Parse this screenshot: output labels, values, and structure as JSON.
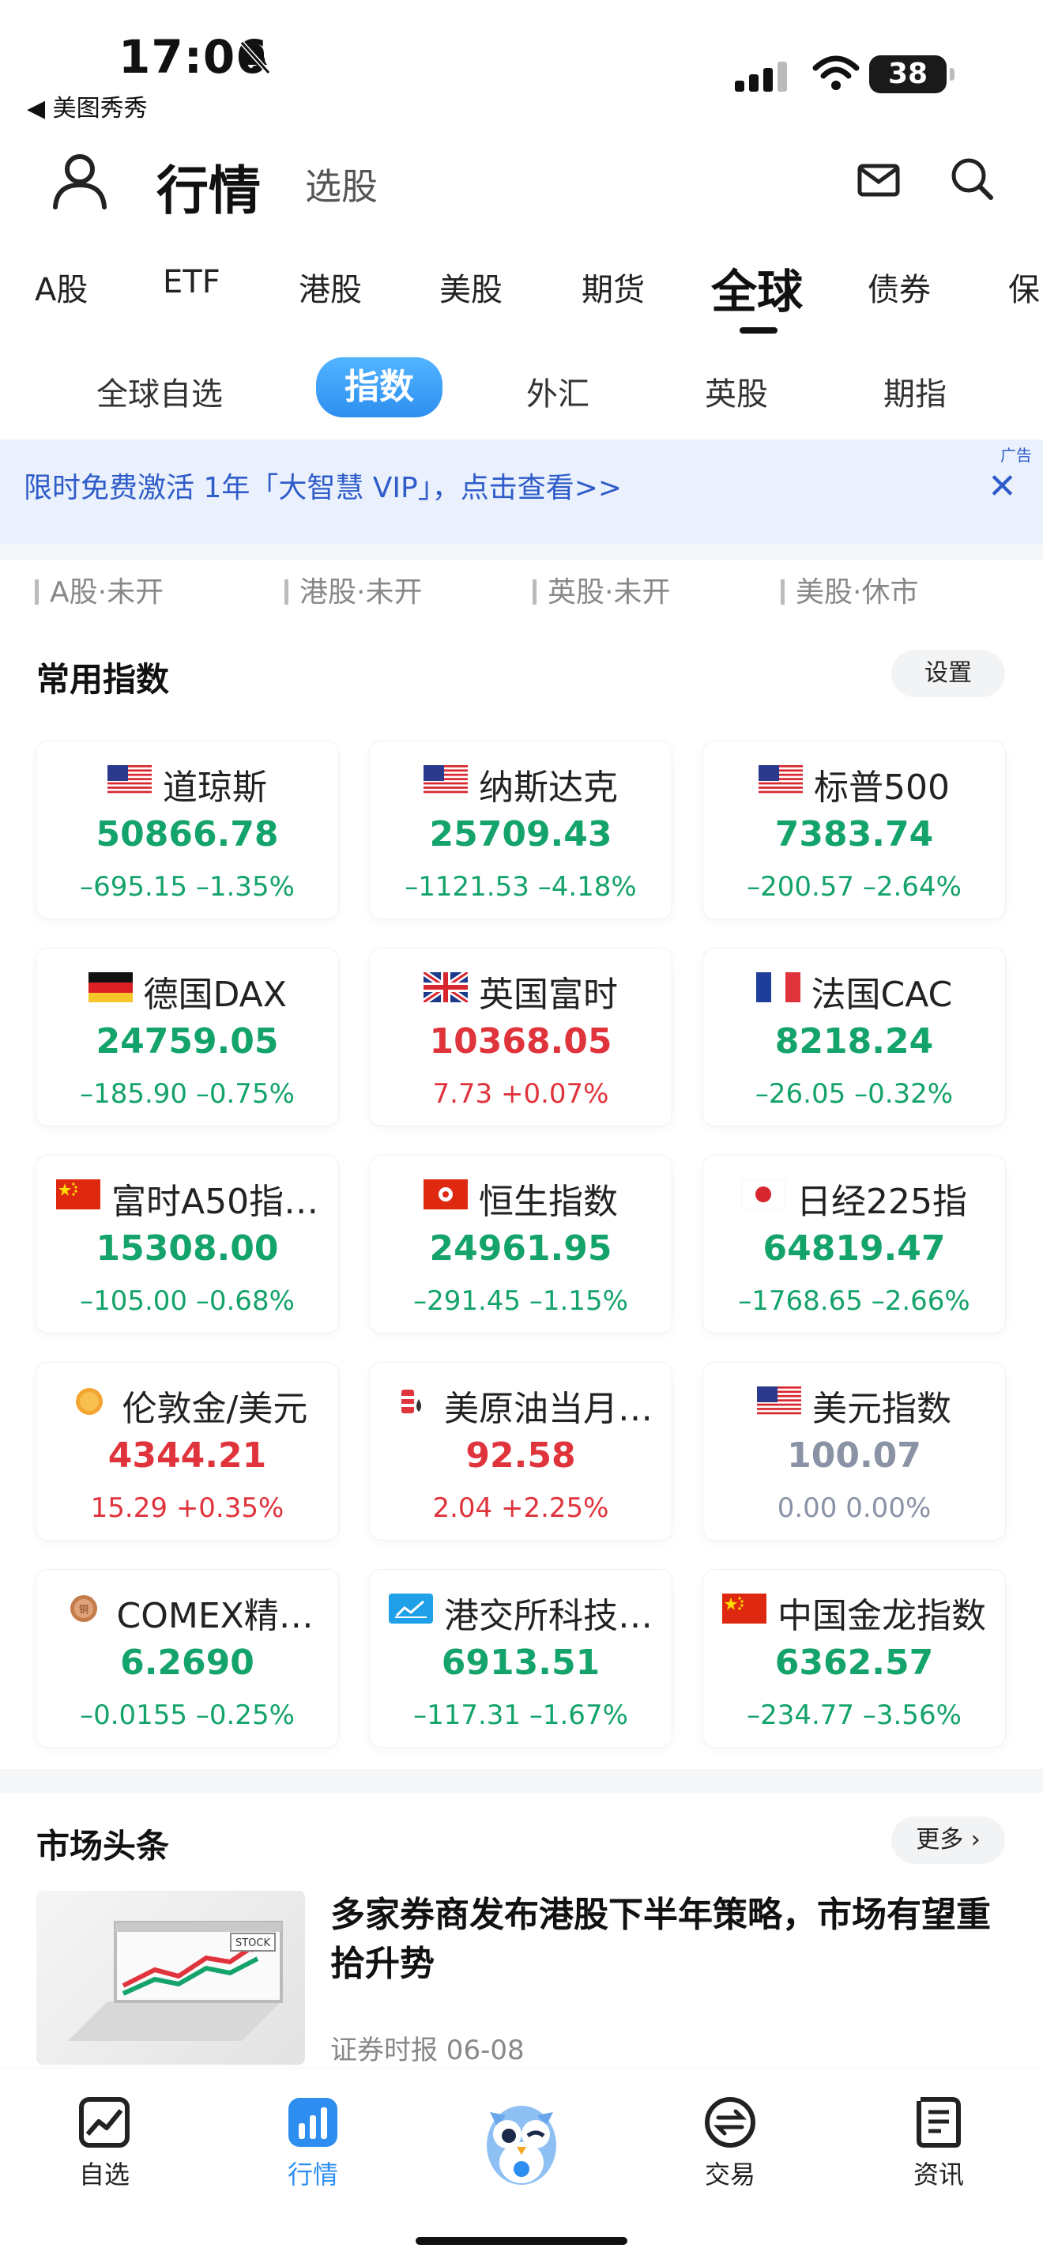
{
  "status_bar": {
    "time": "17:06",
    "back_label": "◀ 美图秀秀",
    "battery": "38"
  },
  "header": {
    "title": "行情",
    "subtitle": "选股"
  },
  "tabs": [
    "A股",
    "ETF",
    "港股",
    "美股",
    "期货",
    "全球",
    "债券",
    "保"
  ],
  "active_tab": "全球",
  "sub_tabs": [
    "全球自选",
    "指数",
    "外汇",
    "英股",
    "期指"
  ],
  "active_sub_tab": "指数",
  "ad": {
    "text": "限时免费激活 1年「大智慧 VIP」，点击查看>>",
    "tag": "广告",
    "close": "✕"
  },
  "market_status": [
    "A股·未开",
    "港股·未开",
    "英股·未开",
    "美股·休市"
  ],
  "indices_section": {
    "title": "常用指数",
    "settings_label": "设置"
  },
  "indices": [
    {
      "name": "道琼斯",
      "price": "50866.78",
      "change": "–695.15 –1.35%",
      "trend": "down",
      "icon": "us-flag-icon"
    },
    {
      "name": "纳斯达克",
      "price": "25709.43",
      "change": "–1121.53 –4.18%",
      "trend": "down",
      "icon": "us-flag-icon"
    },
    {
      "name": "标普500",
      "price": "7383.74",
      "change": "–200.57 –2.64%",
      "trend": "down",
      "icon": "us-flag-icon"
    },
    {
      "name": "德国DAX",
      "price": "24759.05",
      "change": "–185.90 –0.75%",
      "trend": "down",
      "icon": "germany-flag-icon"
    },
    {
      "name": "英国富时",
      "price": "10368.05",
      "change": "7.73 +0.07%",
      "trend": "up",
      "icon": "uk-flag-icon"
    },
    {
      "name": "法国CAC",
      "price": "8218.24",
      "change": "–26.05 –0.32%",
      "trend": "down",
      "icon": "france-flag-icon"
    },
    {
      "name": "富时A50指…",
      "price": "15308.00",
      "change": "–105.00 –0.68%",
      "trend": "down",
      "icon": "china-flag-icon"
    },
    {
      "name": "恒生指数",
      "price": "24961.95",
      "change": "–291.45 –1.15%",
      "trend": "down",
      "icon": "hongkong-flag-icon"
    },
    {
      "name": "日经225指",
      "price": "64819.47",
      "change": "–1768.65 –2.66%",
      "trend": "down",
      "icon": "japan-flag-icon"
    },
    {
      "name": "伦敦金/美元",
      "price": "4344.21",
      "change": "15.29 +0.35%",
      "trend": "up",
      "icon": "gold-coin-icon"
    },
    {
      "name": "美原油当月…",
      "price": "92.58",
      "change": "2.04 +2.25%",
      "trend": "up",
      "icon": "oil-barrel-icon"
    },
    {
      "name": "美元指数",
      "price": "100.07",
      "change": "0.00 0.00%",
      "trend": "flat",
      "icon": "us-flag-icon"
    },
    {
      "name": "COMEX精…",
      "price": "6.2690",
      "change": "–0.0155 –0.25%",
      "trend": "down",
      "icon": "copper-coin-icon"
    },
    {
      "name": "港交所科技…",
      "price": "6913.51",
      "change": "–117.31 –1.67%",
      "trend": "down",
      "icon": "chart-icon"
    },
    {
      "name": "中国金龙指数",
      "price": "6362.57",
      "change": "–234.77 –3.56%",
      "trend": "down",
      "icon": "china-flag-icon"
    }
  ],
  "news_section": {
    "title": "市场头条",
    "more_label": "更多 ›"
  },
  "news": {
    "title": "多家券商发布港股下半年策略，市场有望重拾升势",
    "source": "证券时报 06-08",
    "image_text": "STOCK"
  },
  "bottom_nav": [
    {
      "label": "自选",
      "icon": "watchlist-chart-icon"
    },
    {
      "label": "行情",
      "icon": "bar-chart-icon"
    },
    {
      "label": "",
      "icon": "owl-mascot-icon"
    },
    {
      "label": "交易",
      "icon": "exchange-icon"
    },
    {
      "label": "资讯",
      "icon": "news-doc-icon"
    }
  ],
  "active_nav": "行情",
  "colors": {
    "down": "#14a36a",
    "up": "#e0343d",
    "flat": "#8a93a6",
    "accent": "#2d8ef0"
  }
}
